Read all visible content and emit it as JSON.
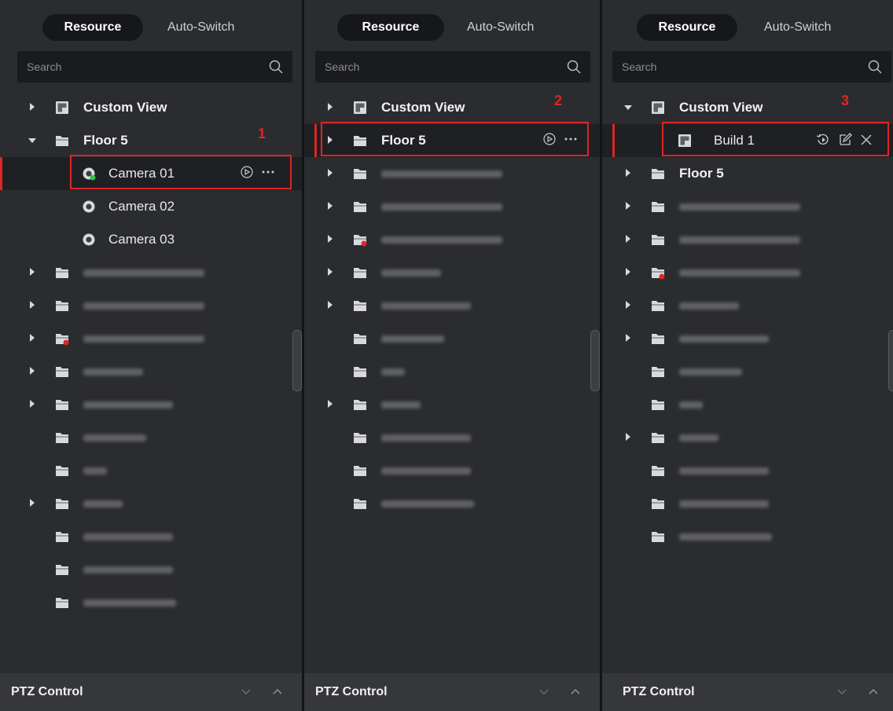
{
  "tabs": {
    "resource": "Resource",
    "auto_switch": "Auto-Switch"
  },
  "search": {
    "placeholder": "Search"
  },
  "ptz": {
    "label": "PTZ Control"
  },
  "markers": [
    "1",
    "2",
    "3"
  ],
  "tree": {
    "custom_view": "Custom View",
    "floor5": "Floor 5",
    "build1": "Build 1",
    "cameras": [
      "Camera 01",
      "Camera 02",
      "Camera 03"
    ]
  },
  "colors": {
    "accent_red": "#e02525",
    "panel_bg": "#2b2c30",
    "selected_bg": "#1f2023"
  },
  "icons": [
    "search-icon",
    "folder-icon",
    "camera-icon",
    "custom-view-icon",
    "play-icon",
    "more-icon",
    "playback-icon",
    "edit-icon",
    "close-icon",
    "chevron-down-icon",
    "chevron-up-icon",
    "expand-arrow-icon",
    "collapse-arrow-icon"
  ]
}
